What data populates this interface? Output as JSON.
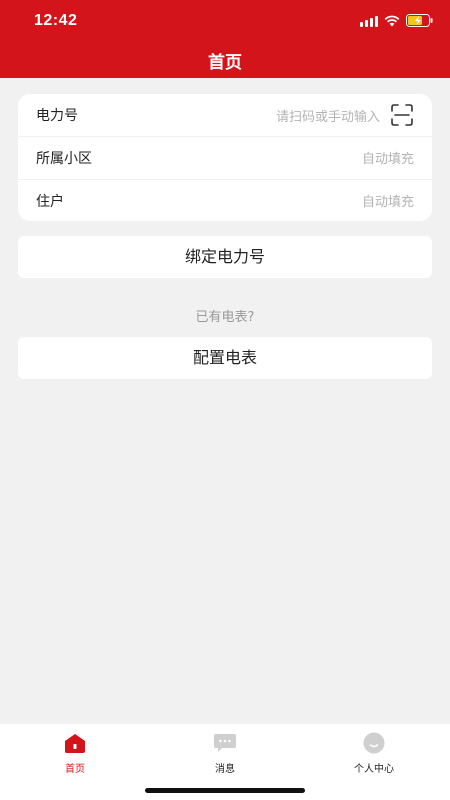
{
  "status_bar": {
    "time": "12:42"
  },
  "header": {
    "title": "首页"
  },
  "form": {
    "power_number": {
      "label": "电力号",
      "placeholder": "请扫码或手动输入"
    },
    "community": {
      "label": "所属小区",
      "placeholder": "自动填充"
    },
    "resident": {
      "label": "住户",
      "placeholder": "自动填充"
    }
  },
  "actions": {
    "bind_label": "绑定电力号",
    "hint": "已有电表?",
    "config_label": "配置电表"
  },
  "tabbar": {
    "items": [
      {
        "label": "首页",
        "icon": "home-icon",
        "active": true
      },
      {
        "label": "消息",
        "icon": "message-icon",
        "active": false
      },
      {
        "label": "个人中心",
        "icon": "profile-icon",
        "active": false
      }
    ]
  },
  "colors": {
    "accent": "#d3141b",
    "background": "#f1f1f1",
    "placeholder": "#b3b3b3"
  }
}
